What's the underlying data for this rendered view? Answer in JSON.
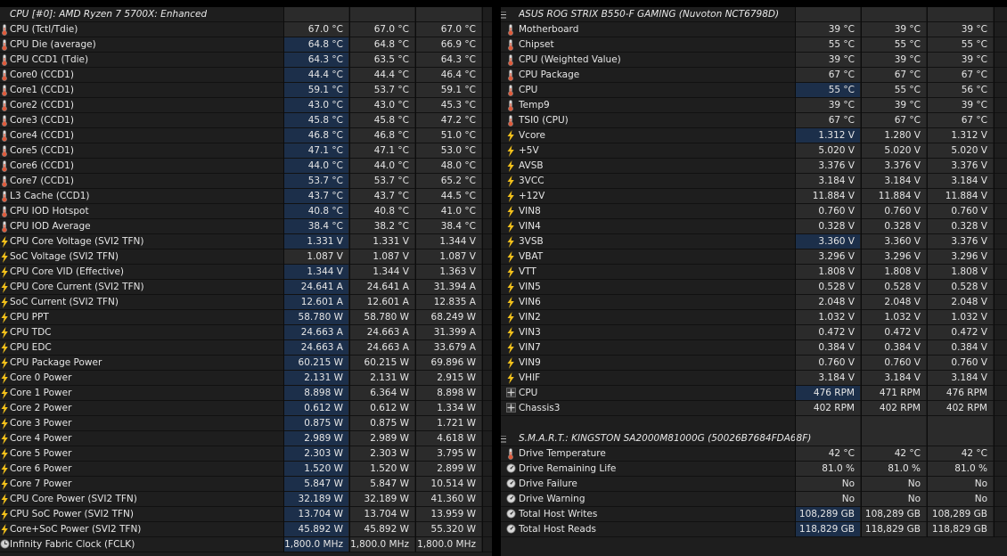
{
  "left_panel": {
    "header": "CPU [#0]: AMD Ryzen 7 5700X: Enhanced",
    "rows": [
      {
        "icon": "thermometer-icon",
        "label": "CPU (Tctl/Tdie)",
        "v1": "67.0 °C",
        "v2": "67.0 °C",
        "v3": "67.0 °C",
        "hl": false
      },
      {
        "icon": "thermometer-icon",
        "label": "CPU Die (average)",
        "v1": "64.8 °C",
        "v2": "64.8 °C",
        "v3": "66.9 °C",
        "hl": true
      },
      {
        "icon": "thermometer-icon",
        "label": "CPU CCD1 (Tdie)",
        "v1": "64.3 °C",
        "v2": "63.5 °C",
        "v3": "64.3 °C",
        "hl": true
      },
      {
        "icon": "thermometer-icon",
        "label": "Core0 (CCD1)",
        "v1": "44.4 °C",
        "v2": "44.4 °C",
        "v3": "46.4 °C",
        "hl": true
      },
      {
        "icon": "thermometer-icon",
        "label": "Core1 (CCD1)",
        "v1": "59.1 °C",
        "v2": "53.7 °C",
        "v3": "59.1 °C",
        "hl": true
      },
      {
        "icon": "thermometer-icon",
        "label": "Core2 (CCD1)",
        "v1": "43.0 °C",
        "v2": "43.0 °C",
        "v3": "45.3 °C",
        "hl": true
      },
      {
        "icon": "thermometer-icon",
        "label": "Core3 (CCD1)",
        "v1": "45.8 °C",
        "v2": "45.8 °C",
        "v3": "47.2 °C",
        "hl": true
      },
      {
        "icon": "thermometer-icon",
        "label": "Core4 (CCD1)",
        "v1": "46.8 °C",
        "v2": "46.8 °C",
        "v3": "51.0 °C",
        "hl": true
      },
      {
        "icon": "thermometer-icon",
        "label": "Core5 (CCD1)",
        "v1": "47.1 °C",
        "v2": "47.1 °C",
        "v3": "53.0 °C",
        "hl": true
      },
      {
        "icon": "thermometer-icon",
        "label": "Core6 (CCD1)",
        "v1": "44.0 °C",
        "v2": "44.0 °C",
        "v3": "48.0 °C",
        "hl": true
      },
      {
        "icon": "thermometer-icon",
        "label": "Core7 (CCD1)",
        "v1": "53.7 °C",
        "v2": "53.7 °C",
        "v3": "65.2 °C",
        "hl": true
      },
      {
        "icon": "thermometer-icon",
        "label": "L3 Cache (CCD1)",
        "v1": "43.7 °C",
        "v2": "43.7 °C",
        "v3": "44.5 °C",
        "hl": true
      },
      {
        "icon": "thermometer-icon",
        "label": "CPU IOD Hotspot",
        "v1": "40.8 °C",
        "v2": "40.8 °C",
        "v3": "41.0 °C",
        "hl": true
      },
      {
        "icon": "thermometer-icon",
        "label": "CPU IOD Average",
        "v1": "38.4 °C",
        "v2": "38.2 °C",
        "v3": "38.4 °C",
        "hl": true
      },
      {
        "icon": "bolt-icon",
        "label": "CPU Core Voltage (SVI2 TFN)",
        "v1": "1.331 V",
        "v2": "1.331 V",
        "v3": "1.344 V",
        "hl": true
      },
      {
        "icon": "bolt-icon",
        "label": "SoC Voltage (SVI2 TFN)",
        "v1": "1.087 V",
        "v2": "1.087 V",
        "v3": "1.087 V",
        "hl": false
      },
      {
        "icon": "bolt-icon",
        "label": "CPU Core VID (Effective)",
        "v1": "1.344 V",
        "v2": "1.344 V",
        "v3": "1.363 V",
        "hl": true
      },
      {
        "icon": "bolt-icon",
        "label": "CPU Core Current (SVI2 TFN)",
        "v1": "24.641 A",
        "v2": "24.641 A",
        "v3": "31.394 A",
        "hl": true
      },
      {
        "icon": "bolt-icon",
        "label": "SoC Current (SVI2 TFN)",
        "v1": "12.601 A",
        "v2": "12.601 A",
        "v3": "12.835 A",
        "hl": true
      },
      {
        "icon": "bolt-icon",
        "label": "CPU PPT",
        "v1": "58.780 W",
        "v2": "58.780 W",
        "v3": "68.249 W",
        "hl": true
      },
      {
        "icon": "bolt-icon",
        "label": "CPU TDC",
        "v1": "24.663 A",
        "v2": "24.663 A",
        "v3": "31.399 A",
        "hl": true
      },
      {
        "icon": "bolt-icon",
        "label": "CPU EDC",
        "v1": "24.663 A",
        "v2": "24.663 A",
        "v3": "33.679 A",
        "hl": true
      },
      {
        "icon": "bolt-icon",
        "label": "CPU Package Power",
        "v1": "60.215 W",
        "v2": "60.215 W",
        "v3": "69.896 W",
        "hl": true
      },
      {
        "icon": "bolt-icon",
        "label": "Core 0 Power",
        "v1": "2.131 W",
        "v2": "2.131 W",
        "v3": "2.915 W",
        "hl": true
      },
      {
        "icon": "bolt-icon",
        "label": "Core 1 Power",
        "v1": "8.898 W",
        "v2": "6.364 W",
        "v3": "8.898 W",
        "hl": true
      },
      {
        "icon": "bolt-icon",
        "label": "Core 2 Power",
        "v1": "0.612 W",
        "v2": "0.612 W",
        "v3": "1.334 W",
        "hl": true
      },
      {
        "icon": "bolt-icon",
        "label": "Core 3 Power",
        "v1": "0.875 W",
        "v2": "0.875 W",
        "v3": "1.721 W",
        "hl": true
      },
      {
        "icon": "bolt-icon",
        "label": "Core 4 Power",
        "v1": "2.989 W",
        "v2": "2.989 W",
        "v3": "4.618 W",
        "hl": true
      },
      {
        "icon": "bolt-icon",
        "label": "Core 5 Power",
        "v1": "2.303 W",
        "v2": "2.303 W",
        "v3": "3.795 W",
        "hl": true
      },
      {
        "icon": "bolt-icon",
        "label": "Core 6 Power",
        "v1": "1.520 W",
        "v2": "1.520 W",
        "v3": "2.899 W",
        "hl": true
      },
      {
        "icon": "bolt-icon",
        "label": "Core 7 Power",
        "v1": "5.847 W",
        "v2": "5.847 W",
        "v3": "10.514 W",
        "hl": true
      },
      {
        "icon": "bolt-icon",
        "label": "CPU Core Power (SVI2 TFN)",
        "v1": "32.189 W",
        "v2": "32.189 W",
        "v3": "41.360 W",
        "hl": true
      },
      {
        "icon": "bolt-icon",
        "label": "CPU SoC Power (SVI2 TFN)",
        "v1": "13.704 W",
        "v2": "13.704 W",
        "v3": "13.959 W",
        "hl": true
      },
      {
        "icon": "bolt-icon",
        "label": "Core+SoC Power (SVI2 TFN)",
        "v1": "45.892 W",
        "v2": "45.892 W",
        "v3": "55.320 W",
        "hl": true
      },
      {
        "icon": "clock-icon",
        "label": "Infinity Fabric Clock (FCLK)",
        "v1": "1,800.0 MHz",
        "v2": "1,800.0 MHz",
        "v3": "1,800.0 MHz",
        "hl": true
      }
    ]
  },
  "right_panel": {
    "header": "ASUS ROG STRIX B550-F GAMING (Nuvoton NCT6798D)",
    "rows": [
      {
        "icon": "thermometer-icon",
        "label": "Motherboard",
        "v1": "39 °C",
        "v2": "39 °C",
        "v3": "39 °C",
        "hl": false
      },
      {
        "icon": "thermometer-icon",
        "label": "Chipset",
        "v1": "55 °C",
        "v2": "55 °C",
        "v3": "55 °C",
        "hl": false
      },
      {
        "icon": "thermometer-icon",
        "label": "CPU (Weighted Value)",
        "v1": "39 °C",
        "v2": "39 °C",
        "v3": "39 °C",
        "hl": false
      },
      {
        "icon": "thermometer-icon",
        "label": "CPU Package",
        "v1": "67 °C",
        "v2": "67 °C",
        "v3": "67 °C",
        "hl": false
      },
      {
        "icon": "thermometer-icon",
        "label": "CPU",
        "v1": "55 °C",
        "v2": "55 °C",
        "v3": "56 °C",
        "hl": true
      },
      {
        "icon": "thermometer-icon",
        "label": "Temp9",
        "v1": "39 °C",
        "v2": "39 °C",
        "v3": "39 °C",
        "hl": false
      },
      {
        "icon": "thermometer-icon",
        "label": "TSI0 (CPU)",
        "v1": "67 °C",
        "v2": "67 °C",
        "v3": "67 °C",
        "hl": false
      },
      {
        "icon": "bolt-icon",
        "label": "Vcore",
        "v1": "1.312 V",
        "v2": "1.280 V",
        "v3": "1.312 V",
        "hl": true
      },
      {
        "icon": "bolt-icon",
        "label": "+5V",
        "v1": "5.020 V",
        "v2": "5.020 V",
        "v3": "5.020 V",
        "hl": false
      },
      {
        "icon": "bolt-icon",
        "label": "AVSB",
        "v1": "3.376 V",
        "v2": "3.376 V",
        "v3": "3.376 V",
        "hl": false
      },
      {
        "icon": "bolt-icon",
        "label": "3VCC",
        "v1": "3.184 V",
        "v2": "3.184 V",
        "v3": "3.184 V",
        "hl": false
      },
      {
        "icon": "bolt-icon",
        "label": "+12V",
        "v1": "11.884 V",
        "v2": "11.884 V",
        "v3": "11.884 V",
        "hl": false
      },
      {
        "icon": "bolt-icon",
        "label": "VIN8",
        "v1": "0.760 V",
        "v2": "0.760 V",
        "v3": "0.760 V",
        "hl": false
      },
      {
        "icon": "bolt-icon",
        "label": "VIN4",
        "v1": "0.328 V",
        "v2": "0.328 V",
        "v3": "0.328 V",
        "hl": false
      },
      {
        "icon": "bolt-icon",
        "label": "3VSB",
        "v1": "3.360 V",
        "v2": "3.360 V",
        "v3": "3.376 V",
        "hl": true
      },
      {
        "icon": "bolt-icon",
        "label": "VBAT",
        "v1": "3.296 V",
        "v2": "3.296 V",
        "v3": "3.296 V",
        "hl": false
      },
      {
        "icon": "bolt-icon",
        "label": "VTT",
        "v1": "1.808 V",
        "v2": "1.808 V",
        "v3": "1.808 V",
        "hl": false
      },
      {
        "icon": "bolt-icon",
        "label": "VIN5",
        "v1": "0.528 V",
        "v2": "0.528 V",
        "v3": "0.528 V",
        "hl": false
      },
      {
        "icon": "bolt-icon",
        "label": "VIN6",
        "v1": "2.048 V",
        "v2": "2.048 V",
        "v3": "2.048 V",
        "hl": false
      },
      {
        "icon": "bolt-icon",
        "label": "VIN2",
        "v1": "1.032 V",
        "v2": "1.032 V",
        "v3": "1.032 V",
        "hl": false
      },
      {
        "icon": "bolt-icon",
        "label": "VIN3",
        "v1": "0.472 V",
        "v2": "0.472 V",
        "v3": "0.472 V",
        "hl": false
      },
      {
        "icon": "bolt-icon",
        "label": "VIN7",
        "v1": "0.384 V",
        "v2": "0.384 V",
        "v3": "0.384 V",
        "hl": false
      },
      {
        "icon": "bolt-icon",
        "label": "VIN9",
        "v1": "0.760 V",
        "v2": "0.760 V",
        "v3": "0.760 V",
        "hl": false
      },
      {
        "icon": "bolt-icon",
        "label": "VHIF",
        "v1": "3.184 V",
        "v2": "3.184 V",
        "v3": "3.184 V",
        "hl": false
      },
      {
        "icon": "fan-icon",
        "label": "CPU",
        "v1": "476 RPM",
        "v2": "471 RPM",
        "v3": "476 RPM",
        "hl": true
      },
      {
        "icon": "fan-icon",
        "label": "Chassis3",
        "v1": "402 RPM",
        "v2": "402 RPM",
        "v3": "402 RPM",
        "hl": false
      }
    ],
    "smart_header": "S.M.A.R.T.: KINGSTON SA2000M81000G (50026B7684FDA68F)",
    "smart_rows": [
      {
        "icon": "thermometer-icon",
        "label": "Drive Temperature",
        "v1": "42 °C",
        "v2": "42 °C",
        "v3": "42 °C",
        "hl": false
      },
      {
        "icon": "gauge-icon",
        "label": "Drive Remaining Life",
        "v1": "81.0 %",
        "v2": "81.0 %",
        "v3": "81.0 %",
        "hl": false
      },
      {
        "icon": "gauge-icon",
        "label": "Drive Failure",
        "v1": "No",
        "v2": "No",
        "v3": "No",
        "hl": false
      },
      {
        "icon": "gauge-icon",
        "label": "Drive Warning",
        "v1": "No",
        "v2": "No",
        "v3": "No",
        "hl": false
      },
      {
        "icon": "gauge-icon",
        "label": "Total Host Writes",
        "v1": "108,289 GB",
        "v2": "108,289 GB",
        "v3": "108,289 GB",
        "hl": true
      },
      {
        "icon": "gauge-icon",
        "label": "Total Host Reads",
        "v1": "118,829 GB",
        "v2": "118,829 GB",
        "v3": "118,829 GB",
        "hl": true
      }
    ]
  },
  "colors": {
    "background": "#000000",
    "panel": "#1e1e1e",
    "value_column": "#2b2b2b",
    "highlight": "#1c2f4a",
    "text": "#e6e6e6",
    "bolt": "#f4c21b"
  }
}
